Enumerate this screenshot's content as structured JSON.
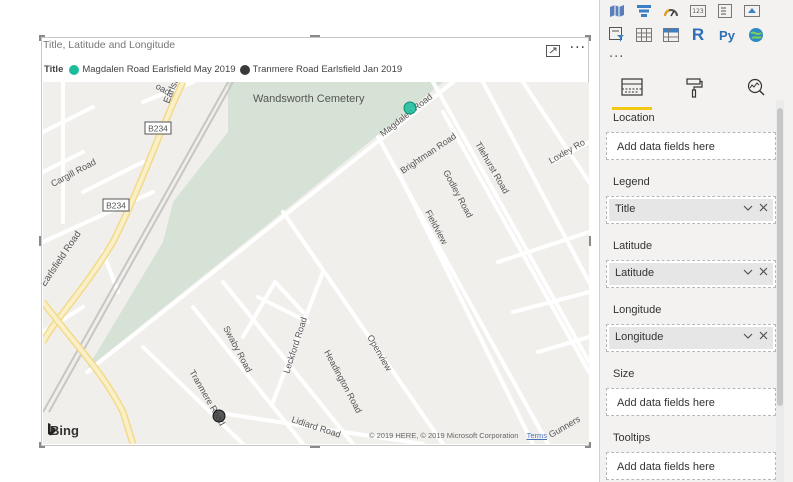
{
  "visual": {
    "title": "Title, Latitude and Longitude",
    "legend": {
      "title": "Title",
      "items": [
        {
          "label": "Magdalen Road Earlsfield May 2019",
          "color": "#1abc9c"
        },
        {
          "label": "Tranmere Road Earlsfield Jan 2019",
          "color": "#3a3a3a"
        }
      ]
    },
    "map": {
      "labels": {
        "cemetery": "Wandsworth Cemetery",
        "b234a": "B234",
        "b234b": "B234",
        "cargill": "Cargill Road",
        "earlsfield": "Earlsfield Road",
        "earlsfield_top": "Earlsfi",
        "top_oad": "oad",
        "magdalen": "Magdalen Road",
        "brightman": "Brightman Road",
        "godley": "Godley Road",
        "tilehurst": "Tilehurst Road",
        "loxley": "Loxley Ro",
        "fieldview": "Fieldview",
        "openview": "Openview",
        "headington": "Headington Road",
        "leckford": "Leckford Road",
        "swaby": "Swaby Road",
        "tranmere": "Tranmere Road",
        "lidiard": "Lidiard Road",
        "gunners": "Gunners"
      },
      "bing": "Bing",
      "copyright": "© 2019 HERE, © 2019 Microsoft Corporation",
      "terms": "Terms"
    }
  },
  "pane": {
    "viz_more": "···",
    "fields": {
      "location": {
        "label": "Location",
        "placeholder": "Add data fields here"
      },
      "legend": {
        "label": "Legend",
        "value": "Title"
      },
      "latitude": {
        "label": "Latitude",
        "value": "Latitude"
      },
      "longitude": {
        "label": "Longitude",
        "value": "Longitude"
      },
      "size": {
        "label": "Size",
        "placeholder": "Add data fields here"
      },
      "tooltips": {
        "label": "Tooltips",
        "placeholder": "Add data fields here"
      }
    },
    "r_label": "R",
    "py_label": "Py"
  },
  "colors": {
    "accent": "#f2c811",
    "point_teal": "#1abc9c",
    "point_dark": "#3a3a3a",
    "cemetery": "#d7e3d7",
    "road_major": "#f7e7a6"
  }
}
